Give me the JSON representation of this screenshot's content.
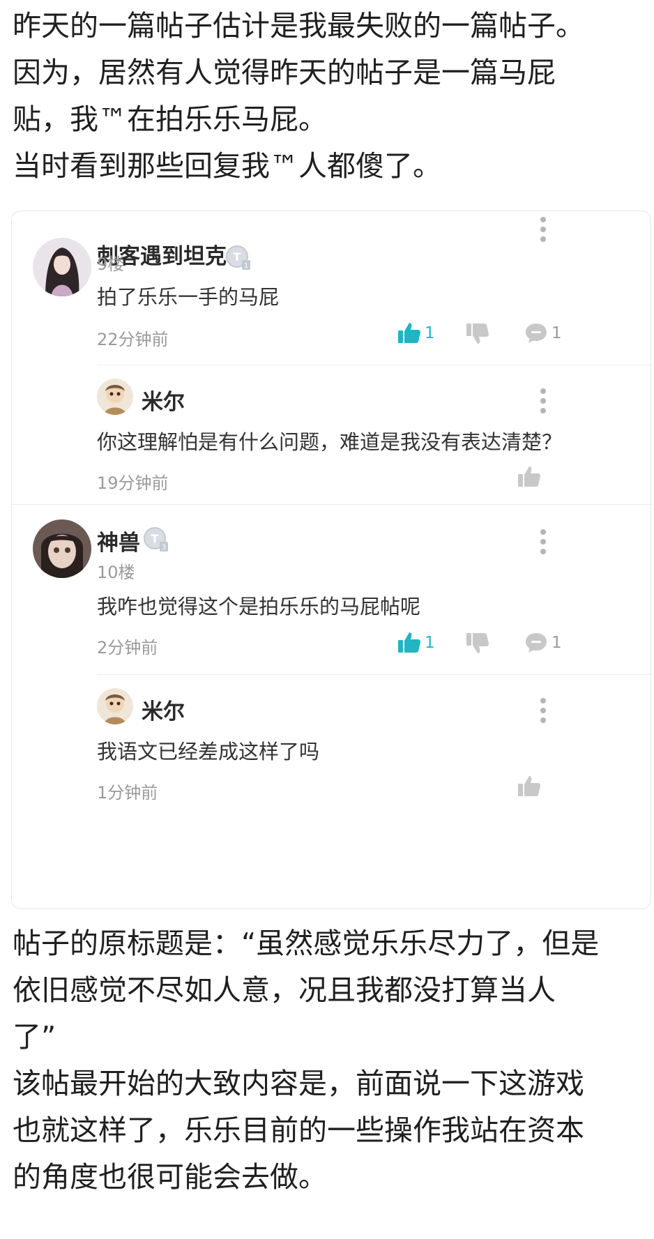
{
  "intro": {
    "lines": [
      "昨天的一篇帖子估计是我最失败的一篇帖子。",
      "因为，居然有人觉得昨天的帖子是一篇马屁",
      "贴，我™在拍乐乐马屁。",
      "当时看到那些回复我™人都傻了。"
    ]
  },
  "comments": [
    {
      "username": "刺客遇到坦克",
      "level": "T1",
      "floor": "9楼",
      "text": "拍了乐乐一手的马屁",
      "time": "22分钟前",
      "likes": "1",
      "replies_count": "1",
      "reply": {
        "username": "米尔",
        "text": "你这理解怕是有什么问题，难道是我没有表达清楚？",
        "time": "19分钟前"
      }
    },
    {
      "username": "神兽",
      "level": "T3",
      "floor": "10楼",
      "text": "我咋也觉得这个是拍乐乐的马屁帖呢",
      "time": "2分钟前",
      "likes": "1",
      "replies_count": "1",
      "reply": {
        "username": "米尔",
        "text": "我语文已经差成这样了吗",
        "time": "1分钟前"
      }
    }
  ],
  "body": {
    "lines": [
      "帖子的原标题是：“虽然感觉乐乐尽力了，但是",
      "依旧感觉不尽如人意，况且我都没打算当人",
      "了”",
      "该帖最开始的大致内容是，前面说一下这游戏",
      "也就这样了，乐乐目前的一些操作我站在资本",
      "的角度也很可能会去做。"
    ]
  },
  "icons": {
    "avatar": "user-avatar",
    "level_badge": "level-badge-icon",
    "like": "thumbs-up-icon",
    "dislike": "thumbs-down-icon",
    "reply": "comment-bubble-icon",
    "more": "more-vertical-icon"
  },
  "colors": {
    "accent": "#21b5c3",
    "muted": "#9a9a9a",
    "icon_gray": "#c8c8c8"
  }
}
